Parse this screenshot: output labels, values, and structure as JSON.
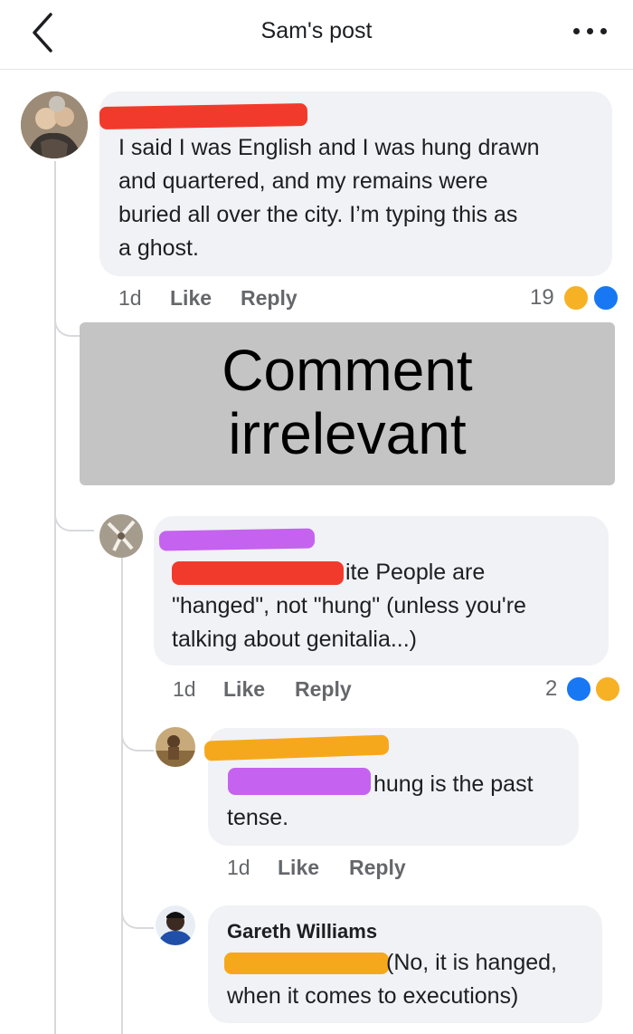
{
  "header": {
    "back_icon": "chevron-left-icon",
    "title": "Sam's post",
    "more_icon": "more-horizontal-icon"
  },
  "comments": [
    {
      "name": "",
      "text": "I said I was English and I was hung drawn and quartered, and my remains were buried all over the city.  I’m typing this as a ghost.",
      "lines": [
        "I said I was English and I was hung drawn",
        "and quartered, and my remains were",
        "buried all over the city.  I’m typing this as",
        "a ghost."
      ],
      "time": "1d",
      "like": "Like",
      "reply": "Reply",
      "reaction_count": "19",
      "reactions": [
        "haha-icon",
        "like-icon"
      ]
    },
    {
      "name": "",
      "mention_tail": "ite",
      "text": "People are \"hanged\", not \"hung\" (unless you're talking about genitalia...)",
      "lines": [
        "ite People are",
        "\"hanged\", not \"hung\" (unless you're",
        "talking about genitalia...)"
      ],
      "time": "1d",
      "like": "Like",
      "reply": "Reply",
      "reaction_count": "2",
      "reactions": [
        "like-icon",
        "haha-icon"
      ]
    },
    {
      "name": "",
      "lines": [
        "hung is the past",
        "tense."
      ],
      "time": "1d",
      "like": "Like",
      "reply": "Reply"
    },
    {
      "name": "Gareth Williams",
      "lines": [
        "(No, it is hanged,",
        "when it comes to executions)"
      ]
    }
  ],
  "overlay": {
    "lines": [
      "Comment",
      "irrelevant"
    ]
  },
  "colors": {
    "redact_red": "#f23a2c",
    "redact_purple": "#c562ef",
    "redact_orange": "#f6a81c",
    "bubble": "#f0f2f5",
    "overlay": "#c4c4c4"
  }
}
